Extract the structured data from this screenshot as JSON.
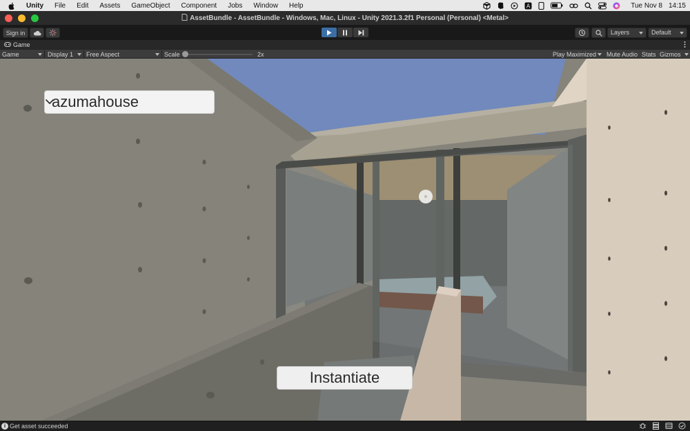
{
  "menubar": {
    "app_name": "Unity",
    "items": [
      "File",
      "Edit",
      "Assets",
      "GameObject",
      "Component",
      "Jobs",
      "Window",
      "Help"
    ],
    "clock_day": "Tue Nov 8",
    "clock_time": "14:15",
    "status_icons": [
      "unity-hub-icon",
      "evernote-icon",
      "play-circle-icon",
      "a-icon",
      "phone-icon",
      "battery-icon",
      "link-icon",
      "search-icon",
      "control-center-icon",
      "siri-icon"
    ]
  },
  "window": {
    "title": "AssetBundle - AssetBundle - Windows, Mac, Linux - Unity 2021.3.2f1 Personal (Personal) <Metal>",
    "traffic_colors": [
      "#ff5f57",
      "#febc2e",
      "#28c840"
    ]
  },
  "toolbar": {
    "sign_in_label": "Sign in",
    "layers_label": "Layers",
    "layout_label": "Default"
  },
  "tab": {
    "label": "Game"
  },
  "game_toolbar": {
    "display_mode": "Game",
    "display": "Display 1",
    "aspect": "Free Aspect",
    "scale_label": "Scale",
    "scale_value": "2x",
    "play_mode": "Play Maximized",
    "mute_label": "Mute Audio",
    "stats_label": "Stats",
    "gizmos_label": "Gizmos"
  },
  "scene_ui": {
    "dropdown_value": "azumahouse",
    "button_label": "Instantiate"
  },
  "status": {
    "message": "Get asset succeeded"
  },
  "colors": {
    "play_active": "#3b6ea5",
    "sky": "#7189bd"
  }
}
